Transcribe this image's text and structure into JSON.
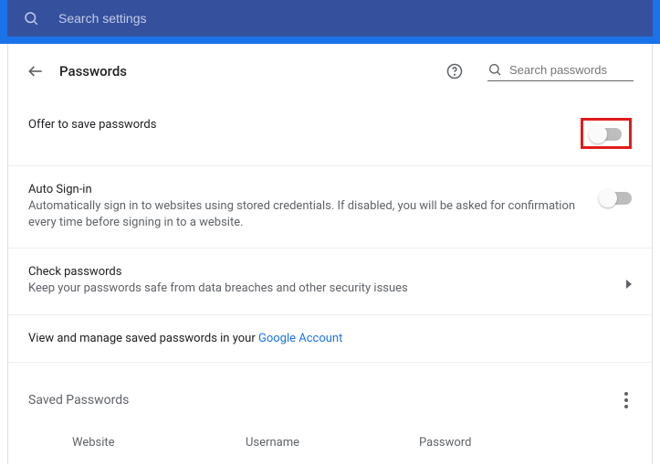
{
  "topbar": {
    "placeholder": "Search settings"
  },
  "header": {
    "title": "Passwords",
    "search_placeholder": "Search passwords"
  },
  "rows": {
    "offer": {
      "title": "Offer to save passwords"
    },
    "auto": {
      "title": "Auto Sign-in",
      "desc": "Automatically sign in to websites using stored credentials. If disabled, you will be asked for confirmation every time before signing in to a website."
    },
    "check": {
      "title": "Check passwords",
      "desc": "Keep your passwords safe from data breaches and other security issues"
    },
    "view": {
      "prefix": "View and manage saved passwords in your ",
      "link": "Google Account"
    }
  },
  "saved": {
    "heading": "Saved Passwords",
    "cols": {
      "website": "Website",
      "username": "Username",
      "password": "Password"
    }
  }
}
